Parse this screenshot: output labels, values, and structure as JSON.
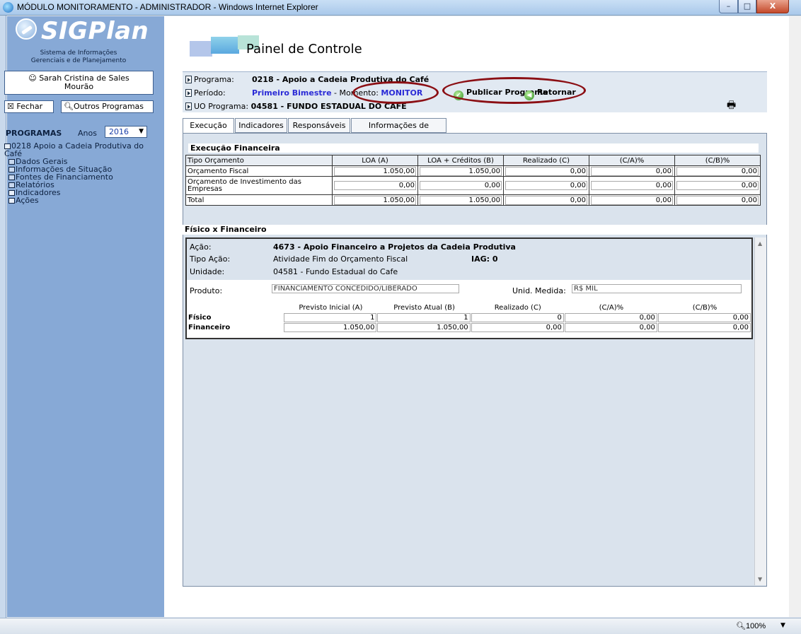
{
  "window": {
    "title": "MÓDULO MONITORAMENTO - ADMINISTRADOR - Windows Internet Explorer",
    "minimize": "–",
    "maximize": "□",
    "close": "X"
  },
  "sidebar": {
    "brand": "SIGPlan",
    "subtitle_line1": "Sistema de Informações",
    "subtitle_line2": "Gerenciais e de Planejamento",
    "user_icon": "user-icon",
    "user_line1": "Sarah Cristina de Sales",
    "user_line2": "Mourão",
    "fechar_label": "Fechar",
    "outros_label": "Outros Programas",
    "programas_label": "PROGRAMAS",
    "anos_label": "Anos",
    "anos_value": "2016",
    "tree_root": "0218 Apoio a Cadeia Produtiva do Café",
    "tree_items": [
      "Dados Gerais",
      "Informações de Situação",
      "Fontes de Financiamento",
      "Relatórios",
      "Indicadores",
      "Ações"
    ]
  },
  "header": {
    "title": "Painel de Controle"
  },
  "info": {
    "programa_label": "Programa:",
    "programa_value": "0218 - Apoio a Cadeia Produtiva do Café",
    "periodo_label": "Período:",
    "periodo_value": "Primeiro Bimestre",
    "momento_label": " - Momento: ",
    "momento_value": "MONITOR",
    "uo_label": "UO Programa:",
    "uo_value": "04581 - FUNDO ESTADUAL DO CAFE",
    "publicar_label": "Publicar Programa",
    "retornar_label": "Retornar"
  },
  "tabs": [
    "Execução",
    "Indicadores",
    "Responsáveis",
    "Informações de Validação"
  ],
  "execucao": {
    "title": "Execução Financeira",
    "columns": [
      "Tipo Orçamento",
      "LOA (A)",
      "LOA + Créditos (B)",
      "Realizado (C)",
      "(C/A)%",
      "(C/B)%"
    ],
    "rows": [
      {
        "tipo": "Orçamento Fiscal",
        "values": [
          "1.050,00",
          "1.050,00",
          "0,00",
          "0,00",
          "0,00"
        ]
      },
      {
        "tipo": "Orçamento de Investimento das Empresas",
        "values": [
          "0,00",
          "0,00",
          "0,00",
          "0,00",
          "0,00"
        ]
      },
      {
        "tipo": "Total",
        "values": [
          "1.050,00",
          "1.050,00",
          "0,00",
          "0,00",
          "0,00"
        ]
      }
    ]
  },
  "fisico": {
    "title": "Físico x Financeiro",
    "acao_label": "Ação:",
    "acao_value": "4673 - Apoio Financeiro a Projetos da Cadeia Produtiva",
    "tipo_label": "Tipo Ação:",
    "tipo_value": "Atividade Fim do Orçamento Fiscal",
    "iag": "IAG: 0",
    "unidade_label": "Unidade:",
    "unidade_value": "04581 - Fundo Estadual do Cafe",
    "produto_label": "Produto:",
    "produto_value": "FINANCIAMENTO CONCEDIDO/LIBERADO",
    "unid_label": "Unid. Medida:",
    "unid_value": "R$ MIL",
    "columns": [
      "Previsto Inicial (A)",
      "Previsto Atual (B)",
      "Realizado (C)",
      "(C/A)%",
      "(C/B)%"
    ],
    "rows": [
      {
        "label": "Físico",
        "values": [
          "1",
          "1",
          "0",
          "0,00",
          "0,00"
        ]
      },
      {
        "label": "Financeiro",
        "values": [
          "1.050,00",
          "1.050,00",
          "0,00",
          "0,00",
          "0,00"
        ]
      }
    ]
  },
  "status": {
    "zoom": "100%"
  }
}
